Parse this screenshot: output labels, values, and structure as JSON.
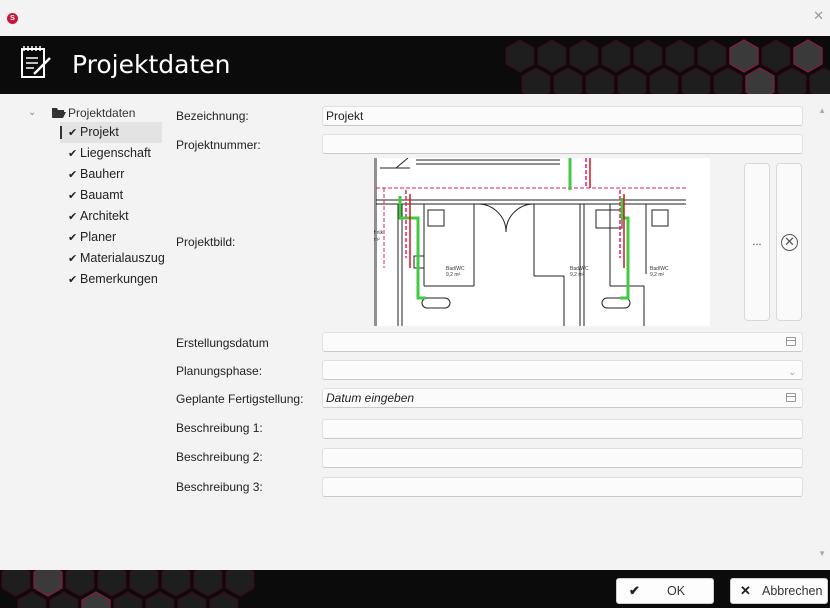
{
  "window": {
    "title": "Projektdaten"
  },
  "tree": {
    "root_label": "Projektdaten",
    "items": [
      {
        "label": "Projekt",
        "selected": true
      },
      {
        "label": "Liegenschaft"
      },
      {
        "label": "Bauherr"
      },
      {
        "label": "Bauamt"
      },
      {
        "label": "Architekt"
      },
      {
        "label": "Planer"
      },
      {
        "label": "Materialauszug"
      },
      {
        "label": "Bemerkungen"
      }
    ]
  },
  "form": {
    "bezeichnung_label": "Bezeichnung:",
    "bezeichnung_value": "Projekt",
    "projektnummer_label": "Projektnummer:",
    "projektnummer_value": "",
    "projektbild_label": "Projektbild:",
    "projektbild_browse": "...",
    "erstellungsdatum_label": "Erstellungsdatum",
    "erstellungsdatum_value": "",
    "planungsphase_label": "Planungsphase:",
    "planungsphase_value": "",
    "fertigstellung_label": "Geplante Fertigstellung:",
    "fertigstellung_placeholder": "Datum eingeben",
    "beschreibung1_label": "Beschreibung 1:",
    "beschreibung1_value": "",
    "beschreibung2_label": "Beschreibung 2:",
    "beschreibung2_value": "",
    "beschreibung3_label": "Beschreibung 3:",
    "beschreibung3_value": ""
  },
  "plan": {
    "room_name": "Bad/WC",
    "room_area": "9,2 m²",
    "left_label_1": "hnik",
    "left_label_2": "m²"
  },
  "footer": {
    "ok_label": "OK",
    "cancel_label": "Abbrechen"
  },
  "colors": {
    "header_bg": "#0b0b0b",
    "accent_pink": "#c4183c"
  }
}
